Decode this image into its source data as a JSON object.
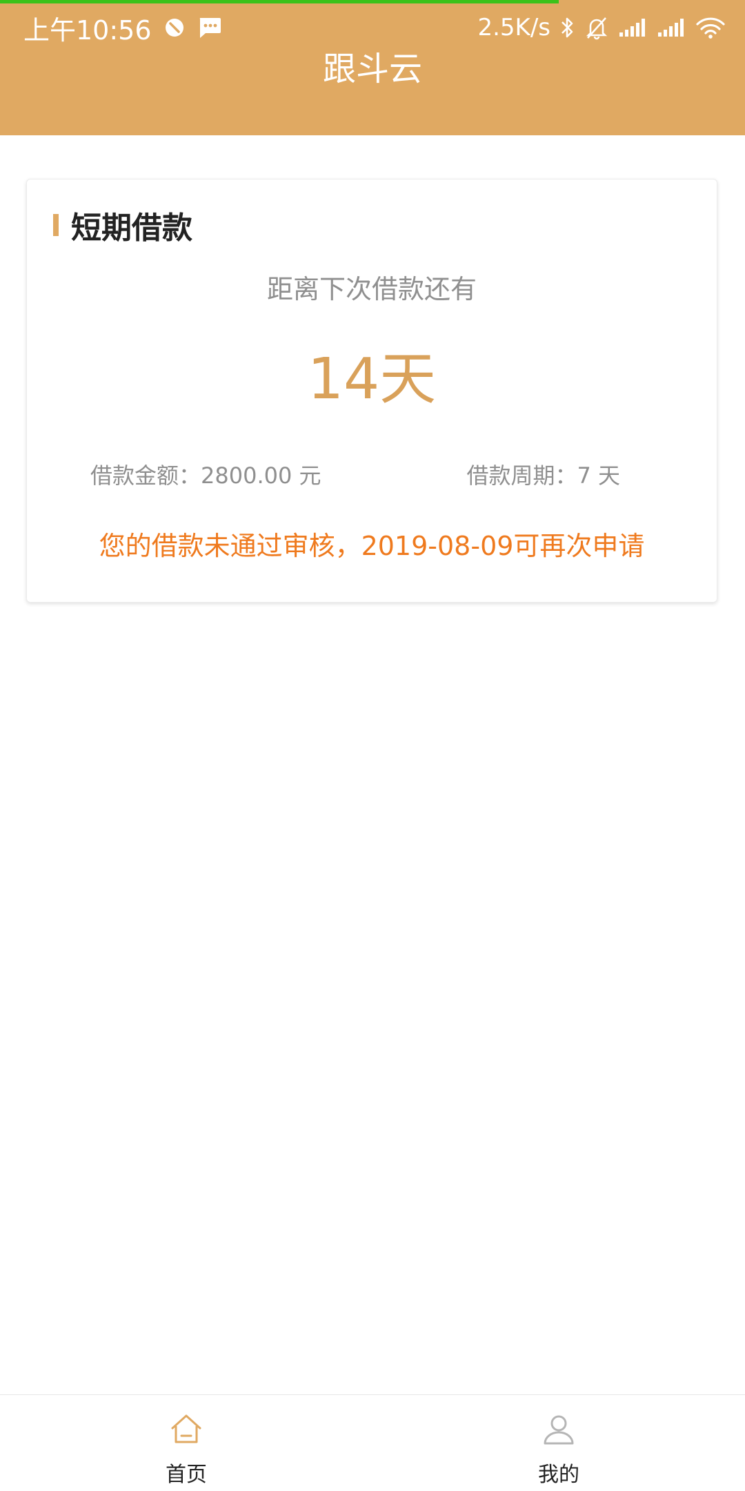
{
  "status_bar": {
    "time": "上午10:56",
    "network_speed": "2.5K/s",
    "icons": [
      "blocked-icon",
      "message-icon",
      "bluetooth-icon",
      "mute-bell-icon",
      "signal-icon",
      "signal-icon",
      "wifi-icon"
    ]
  },
  "header": {
    "title": "跟斗云"
  },
  "card": {
    "title": "短期借款",
    "countdown_label": "距离下次借款还有",
    "countdown_value": "14天",
    "amount_text": "借款金额：2800.00 元",
    "period_text": "借款周期：7 天",
    "notice": "您的借款未通过审核，2019-08-09可再次申请"
  },
  "tabbar": {
    "items": [
      {
        "label": "首页",
        "icon": "home-icon",
        "active": true
      },
      {
        "label": "我的",
        "icon": "user-icon",
        "active": false
      }
    ]
  },
  "colors": {
    "header": "#e0a962",
    "accent": "#d9a15a",
    "notice": "#ef7a1e",
    "loading": "#3cc21a"
  }
}
